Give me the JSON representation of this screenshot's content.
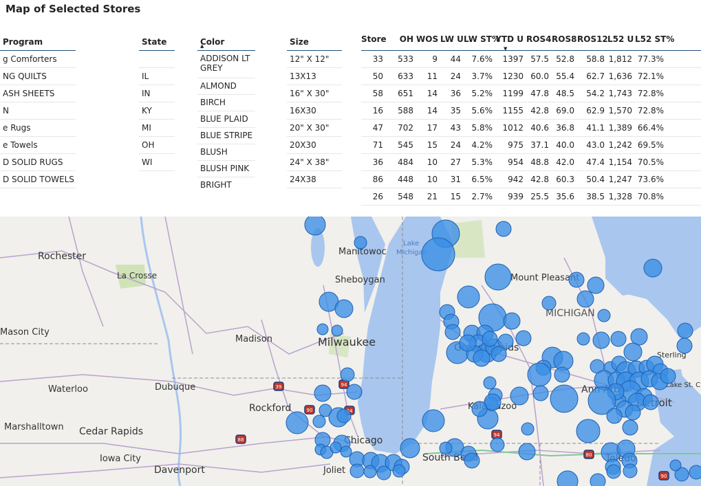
{
  "title": "Map of Selected Stores",
  "slicers": {
    "program": {
      "header": "Program",
      "items": [
        "g Comforters",
        "NG QUILTS",
        "ASH SHEETS",
        "N",
        "e Rugs",
        "e Towels",
        "D SOLID RUGS",
        "D SOLID TOWELS"
      ]
    },
    "state": {
      "header": "State",
      "items": [
        "",
        "IL",
        "IN",
        "KY",
        "MI",
        "OH",
        "WI"
      ]
    },
    "color": {
      "header": "Color",
      "items": [
        "ADDISON LT GREY",
        "ALMOND",
        "BIRCH",
        "BLUE PLAID",
        "BLUE STRIPE",
        "BLUSH",
        "BLUSH PINK",
        "BRIGHT"
      ]
    },
    "size": {
      "header": "Size",
      "items": [
        "12\" X 12\"",
        "13X13",
        "16\" X 30\"",
        "16X30",
        "20\" X 30\"",
        "20X30",
        "24\" X 38\"",
        "24X38"
      ]
    }
  },
  "table": {
    "columns": [
      "Store",
      "OH",
      "WOS",
      "LW U",
      "LW ST%",
      "YTD U",
      "ROS4",
      "ROS8",
      "ROS12",
      "L52 U",
      "L52 ST%"
    ],
    "rows": [
      [
        "33",
        "533",
        "9",
        "44",
        "7.6%",
        "1397",
        "57.5",
        "52.8",
        "58.8",
        "1,812",
        "77.3%"
      ],
      [
        "50",
        "633",
        "11",
        "24",
        "3.7%",
        "1230",
        "60.0",
        "55.4",
        "62.7",
        "1,636",
        "72.1%"
      ],
      [
        "58",
        "651",
        "14",
        "36",
        "5.2%",
        "1199",
        "47.8",
        "48.5",
        "54.2",
        "1,743",
        "72.8%"
      ],
      [
        "16",
        "588",
        "14",
        "35",
        "5.6%",
        "1155",
        "42.8",
        "69.0",
        "62.9",
        "1,570",
        "72.8%"
      ],
      [
        "47",
        "702",
        "17",
        "43",
        "5.8%",
        "1012",
        "40.6",
        "36.8",
        "41.1",
        "1,389",
        "66.4%"
      ],
      [
        "71",
        "545",
        "15",
        "24",
        "4.2%",
        "975",
        "37.1",
        "40.0",
        "43.0",
        "1,242",
        "69.5%"
      ],
      [
        "36",
        "484",
        "10",
        "27",
        "5.3%",
        "954",
        "48.8",
        "42.0",
        "47.4",
        "1,154",
        "70.5%"
      ],
      [
        "86",
        "448",
        "10",
        "31",
        "6.5%",
        "942",
        "42.8",
        "60.3",
        "50.4",
        "1,247",
        "73.6%"
      ],
      [
        "26",
        "548",
        "21",
        "15",
        "2.7%",
        "939",
        "25.5",
        "35.6",
        "38.5",
        "1,328",
        "70.8%"
      ]
    ]
  },
  "map": {
    "cities": [
      "Rochester",
      "La Crosse",
      "Manitowoc",
      "Sheboygan",
      "Mount Pleasant",
      "MICHIGAN",
      "Mason City",
      "Madison",
      "Milwaukee",
      "Grand Rapids",
      "Sterling",
      "Waterloo",
      "Dubuque",
      "Rockford",
      "Ann Arbor",
      "Lake St. Clair",
      "Detroit",
      "Kalamazoo",
      "Marshalltown",
      "Cedar Rapids",
      "Chicago",
      "Iowa City",
      "Davenport",
      "Joliet",
      "South Bend",
      "Toledo"
    ],
    "water_labels": [
      "Lake",
      "Michigan"
    ],
    "route_shields": [
      "39",
      "94",
      "90",
      "94",
      "88",
      "94",
      "80",
      "90"
    ],
    "colors": {
      "bubble": "#3a8ee6",
      "bubble_stroke": "#1f5fb0",
      "land": "#f1f0ec",
      "water": "#a9c6ee",
      "road": "#b9a1cf"
    }
  }
}
